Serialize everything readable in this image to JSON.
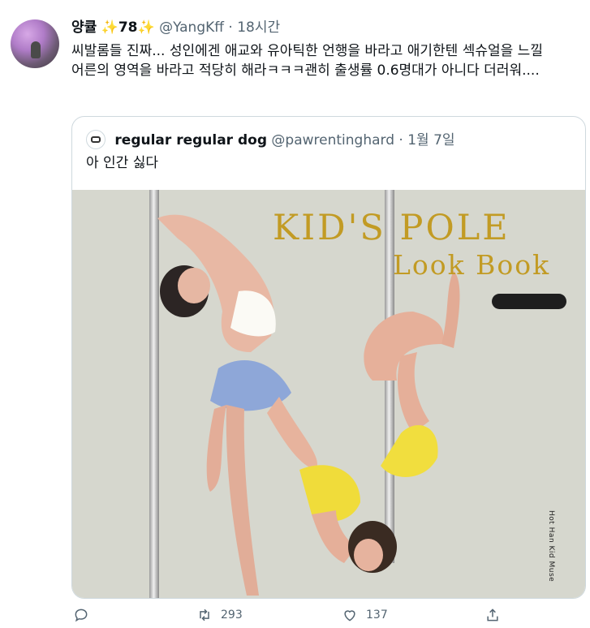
{
  "tweet": {
    "name": "양큘",
    "name_badge": "✨78✨",
    "handle": "@YangKff",
    "separator": "·",
    "time": "18시간",
    "text": "씨발롬들 진짜... 성인에겐 애교와 유아틱한 언행을 바라고 애기한텐 섹슈얼을 느낄 어른의 영역을 바라고 적당히 해라ㅋㅋㅋ괜히 출생률 0.6명대가 아니다 더러워...."
  },
  "quoted": {
    "name": "regular regular dog",
    "handle": "@pawrentinghard",
    "separator": "·",
    "time": "1월 7일",
    "text": "아 인간 싫다",
    "image": {
      "title_line1": "KID'S POLE",
      "title_line2": "Look Book",
      "vertical_label": "Hot Han Kid Muse"
    }
  },
  "actions": {
    "reply_count": "",
    "retweet_count": "293",
    "like_count": "137",
    "share_count": ""
  },
  "colors": {
    "text": "#0f1419",
    "secondary": "#536471",
    "border": "#cfd9de",
    "title_gold": "#c29b24",
    "image_bg": "#d6d7ce"
  }
}
